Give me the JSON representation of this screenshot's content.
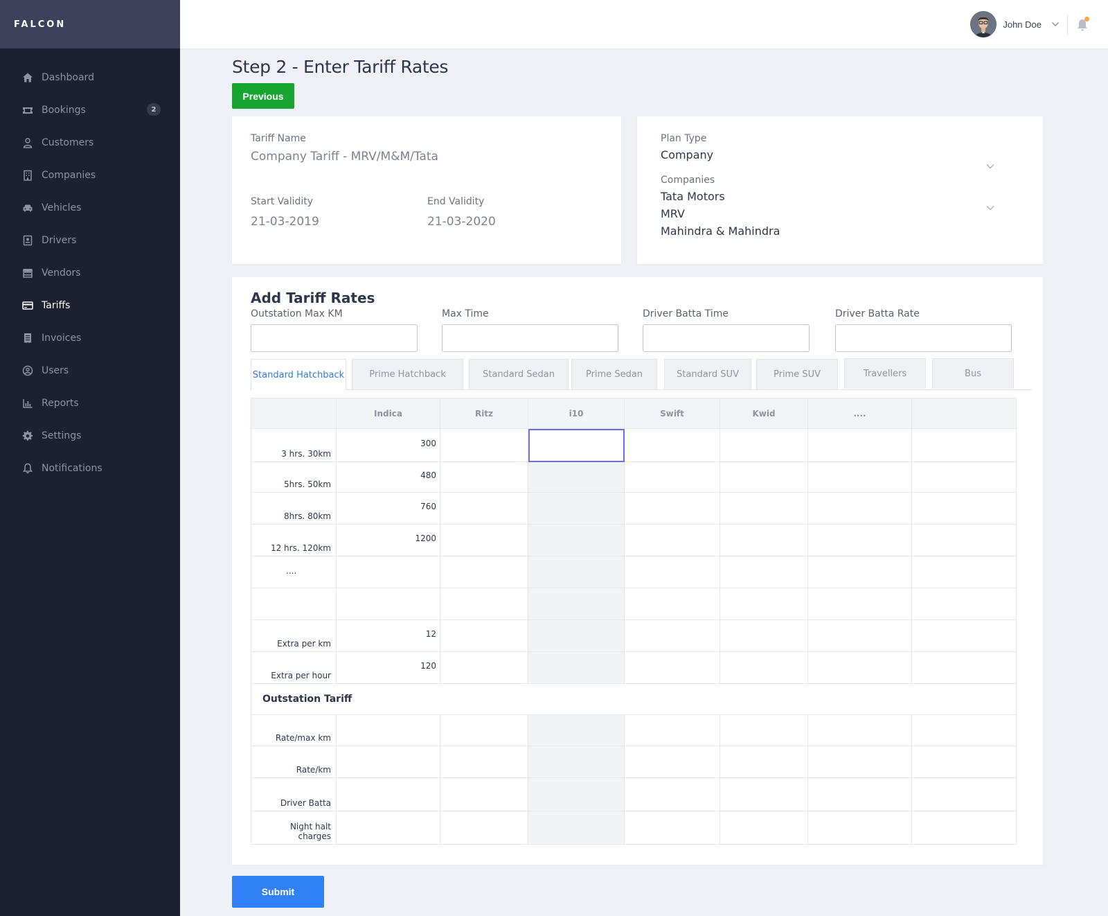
{
  "app": {
    "brand": "FALCON"
  },
  "sidebar": {
    "items": [
      {
        "label": "Dashboard",
        "icon": "home-icon"
      },
      {
        "label": "Bookings",
        "icon": "ticket-icon",
        "badge": "2"
      },
      {
        "label": "Customers",
        "icon": "user-icon"
      },
      {
        "label": "Companies",
        "icon": "building-icon"
      },
      {
        "label": "Vehicles",
        "icon": "car-icon"
      },
      {
        "label": "Drivers",
        "icon": "id-card-icon"
      },
      {
        "label": "Vendors",
        "icon": "store-icon"
      },
      {
        "label": "Tariffs",
        "icon": "credit-card-icon",
        "active": true
      },
      {
        "label": "Invoices",
        "icon": "receipt-icon"
      },
      {
        "label": "Users",
        "icon": "user-circle-icon"
      },
      {
        "label": "Reports",
        "icon": "bar-chart-icon"
      },
      {
        "label": "Settings",
        "icon": "gear-icon"
      },
      {
        "label": "Notifications",
        "icon": "bell-icon"
      }
    ]
  },
  "header": {
    "user_name": "John Doe"
  },
  "page": {
    "title": "Step 2 - Enter Tariff Rates",
    "previous_label": "Previous",
    "submit_label": "Submit"
  },
  "tariff": {
    "name_label": "Tariff Name",
    "name_value": "Company Tariff - MRV/M&M/Tata",
    "start_label": "Start Validity",
    "start_value": "21-03-2019",
    "end_label": "End Validity",
    "end_value": "21-03-2020"
  },
  "plan": {
    "type_label": "Plan Type",
    "type_value": "Company",
    "companies_label": "Companies",
    "companies": [
      "Tata Motors",
      "MRV",
      "Mahindra & Mahindra"
    ]
  },
  "rates": {
    "title": "Add Tariff Rates",
    "fields": [
      {
        "label": "Outstation Max KM",
        "value": ""
      },
      {
        "label": "Max Time",
        "value": ""
      },
      {
        "label": "Driver Batta Time",
        "value": ""
      },
      {
        "label": "Driver Batta Rate",
        "value": ""
      }
    ],
    "tabs": [
      "Standard Hatchback",
      "Prime Hatchback",
      "Standard Sedan",
      "Prime Sedan",
      "Standard SUV",
      "Prime SUV",
      "Travellers",
      "Bus"
    ],
    "columns": [
      "Indica",
      "Ritz",
      "i10",
      "Swift",
      "Kwid",
      "...."
    ],
    "rows": [
      {
        "label": "3 hrs. 30km",
        "cells": [
          "300",
          "",
          "",
          "",
          "",
          "",
          ""
        ]
      },
      {
        "label": "5hrs. 50km",
        "cells": [
          "480",
          "",
          "",
          "",
          "",
          "",
          ""
        ]
      },
      {
        "label": "8hrs. 80km",
        "cells": [
          "760",
          "",
          "",
          "",
          "",
          "",
          ""
        ]
      },
      {
        "label": "12 hrs. 120km",
        "cells": [
          "1200",
          "",
          "",
          "",
          "",
          "",
          ""
        ]
      },
      {
        "label": "....",
        "cells": [
          "",
          "",
          "",
          "",
          "",
          "",
          ""
        ]
      },
      {
        "label": "",
        "cells": [
          "",
          "",
          "",
          "",
          "",
          "",
          ""
        ]
      },
      {
        "label": "Extra per km",
        "cells": [
          "12",
          "",
          "",
          "",
          "",
          "",
          ""
        ]
      },
      {
        "label": "Extra per hour",
        "cells": [
          "120",
          "",
          "",
          "",
          "",
          "",
          ""
        ]
      }
    ],
    "outstation_title": "Outstation Tariff",
    "outstation_rows": [
      {
        "label": "Rate/max km",
        "cells": [
          "",
          "",
          "",
          "",
          "",
          "",
          ""
        ]
      },
      {
        "label": "Rate/km",
        "cells": [
          "",
          "",
          "",
          "",
          "",
          "",
          ""
        ]
      },
      {
        "label": "Driver Batta",
        "cells": [
          "",
          "",
          "",
          "",
          "",
          "",
          ""
        ]
      },
      {
        "label": "Night halt charges",
        "cells": [
          "",
          "",
          "",
          "",
          "",
          "",
          ""
        ]
      }
    ]
  },
  "colors": {
    "sidebar_bg": "#1d2030",
    "brand_bg": "#3e4159",
    "previous_btn": "#18a532",
    "submit_btn": "#3180f5",
    "active_tab": "#2c7be5",
    "focus_outline": "#6b6cf0"
  }
}
